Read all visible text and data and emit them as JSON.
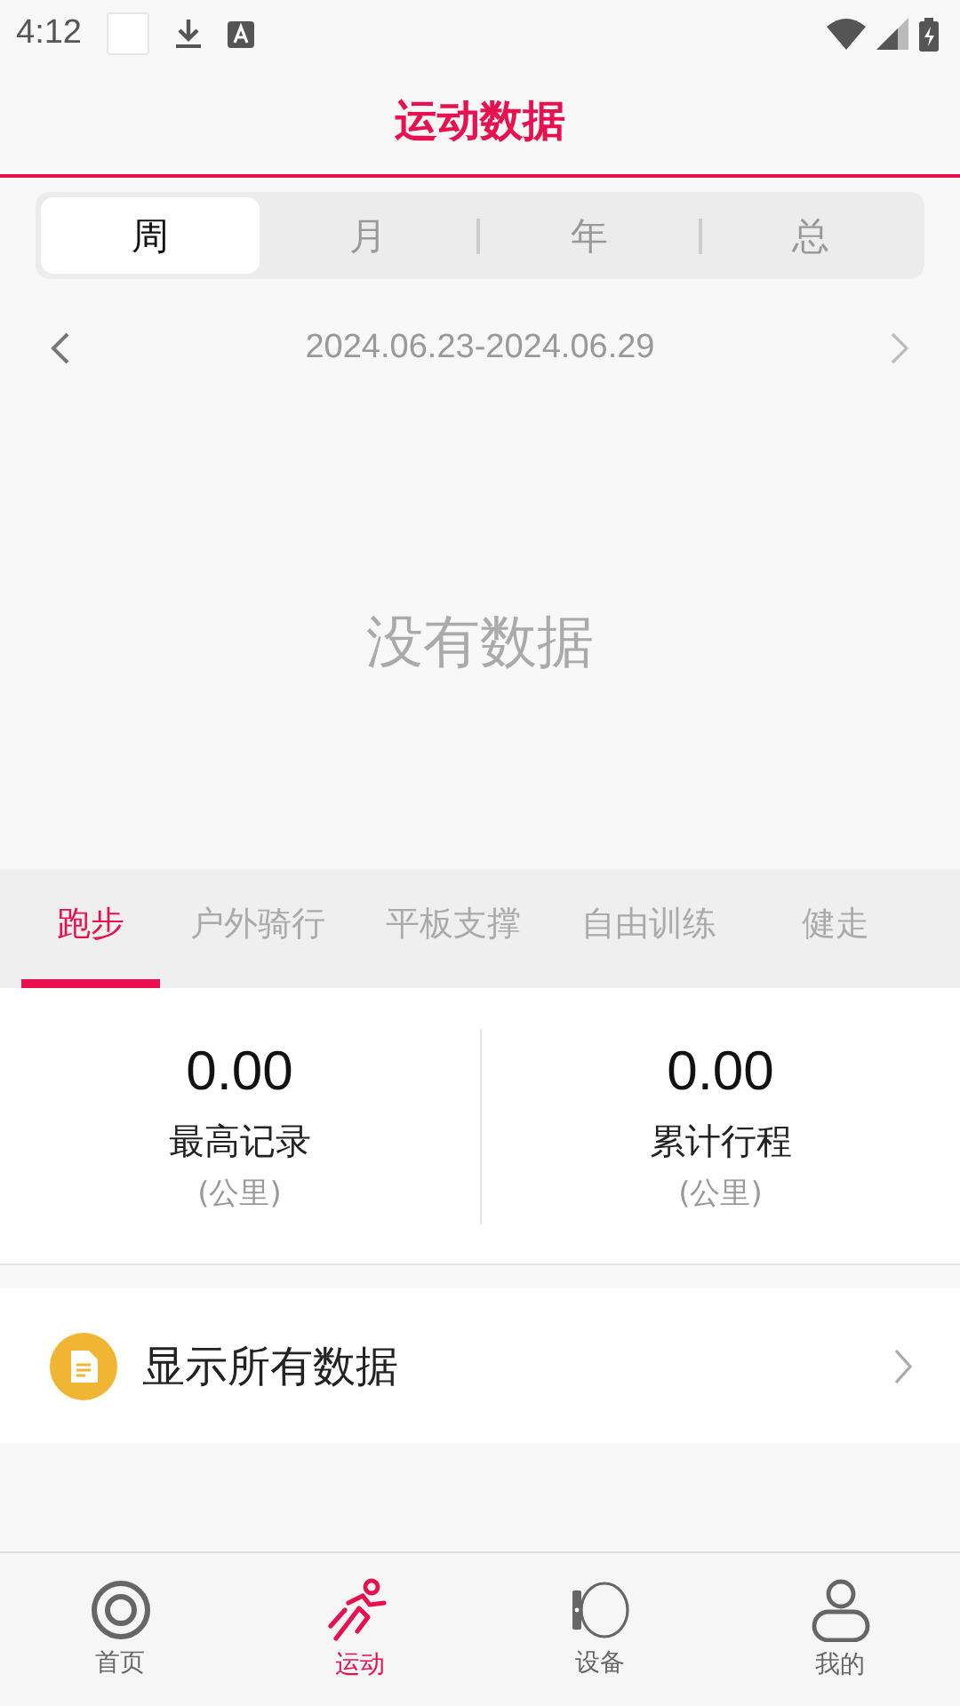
{
  "status_bar": {
    "time": "4:12"
  },
  "title": "运动数据",
  "periods": [
    {
      "label": "周",
      "selected": true
    },
    {
      "label": "月",
      "selected": false
    },
    {
      "label": "年",
      "selected": false
    },
    {
      "label": "总",
      "selected": false
    }
  ],
  "date_range": "2024.06.23-2024.06.29",
  "empty_message": "没有数据",
  "sports": [
    {
      "label": "跑步",
      "selected": true
    },
    {
      "label": "户外骑行",
      "selected": false
    },
    {
      "label": "平板支撑",
      "selected": false
    },
    {
      "label": "自由训练",
      "selected": false
    },
    {
      "label": "健走",
      "selected": false
    }
  ],
  "stats": [
    {
      "value": "0.00",
      "label": "最高记录",
      "unit": "(公里)"
    },
    {
      "value": "0.00",
      "label": "累计行程",
      "unit": "(公里)"
    }
  ],
  "show_all": "显示所有数据",
  "nav": [
    {
      "kind": "home",
      "label": "首页",
      "selected": false
    },
    {
      "kind": "sport",
      "label": "运动",
      "selected": true
    },
    {
      "kind": "device",
      "label": "设备",
      "selected": false
    },
    {
      "kind": "me",
      "label": "我的",
      "selected": false
    }
  ]
}
